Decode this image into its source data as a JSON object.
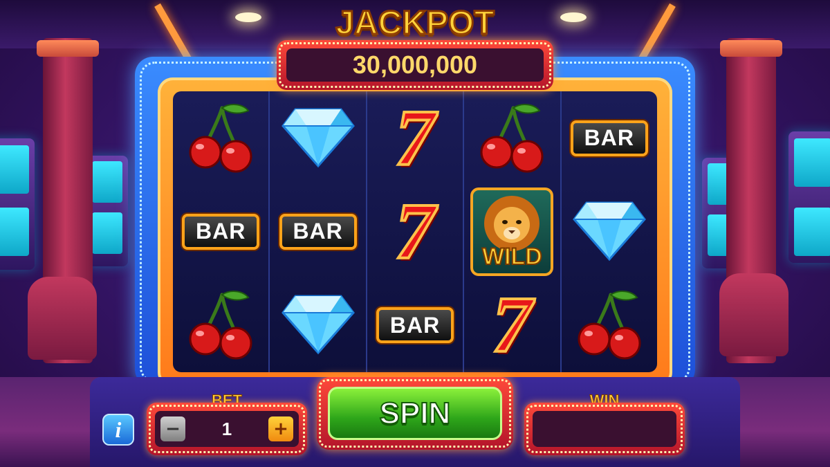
{
  "jackpot": {
    "title": "JACKPOT",
    "amount": "30,000,000"
  },
  "reels": [
    [
      "cherry",
      "bar",
      "cherry"
    ],
    [
      "diamond",
      "bar",
      "diamond"
    ],
    [
      "seven",
      "seven",
      "bar"
    ],
    [
      "cherry",
      "wild",
      "seven"
    ],
    [
      "bar",
      "diamond",
      "cherry"
    ]
  ],
  "symbol_labels": {
    "bar": "BAR",
    "seven": "7",
    "wild": "WILD"
  },
  "controls": {
    "bet_label": "BET",
    "bet_value": "1",
    "bet_minus": "−",
    "bet_plus": "+",
    "spin_label": "SPIN",
    "win_label": "WIN",
    "win_value": "",
    "info_label": "i"
  },
  "colors": {
    "cabinet": "#3a8cff",
    "frame": "#ff9a2a",
    "reel_bg": "#13154a",
    "spin_green": "#2ea61a",
    "gold_text": "#ffd23a"
  }
}
